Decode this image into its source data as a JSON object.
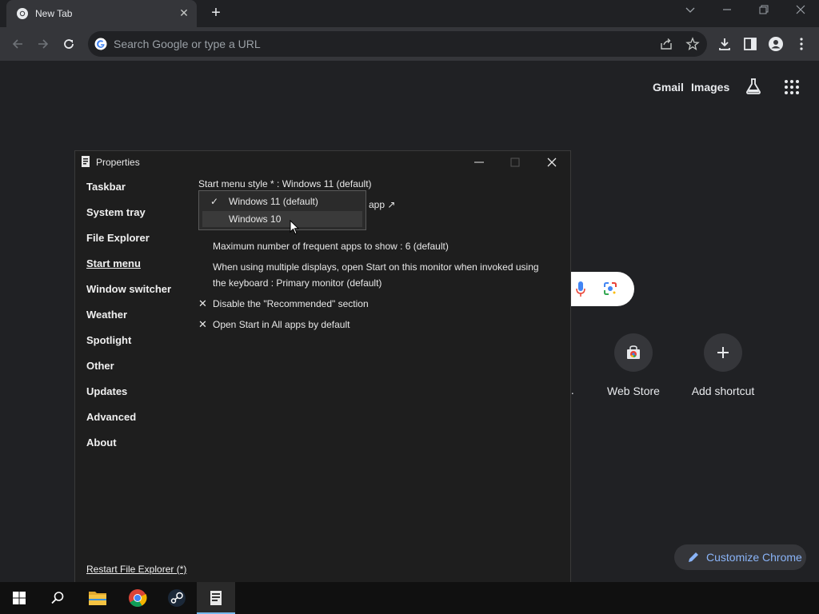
{
  "browser": {
    "tab_title": "New Tab",
    "omnibox_placeholder": "Search Google or type a URL",
    "header_links": [
      "Gmail",
      "Images"
    ],
    "shortcuts": [
      {
        "label": "..."
      },
      {
        "label": "Web Store"
      },
      {
        "label": "Add shortcut"
      }
    ],
    "customize_label": "Customize Chrome"
  },
  "properties_window": {
    "title": "Properties",
    "nav_items": [
      "Taskbar",
      "System tray",
      "File Explorer",
      "Start menu",
      "Window switcher",
      "Weather",
      "Spotlight",
      "Other",
      "Updates",
      "Advanced",
      "About"
    ],
    "active_nav": "Start menu",
    "restart_link": "Restart File Explorer (*)",
    "start_menu_style_label": "Start menu style * : Windows 11 (default)",
    "dropdown_options": [
      {
        "label": "Windows 11 (default)",
        "checked": true
      },
      {
        "label": "Windows 10",
        "checked": false
      }
    ],
    "obscured_fragment": "app ↗",
    "max_frequent_apps": "Maximum number of frequent apps to show : 6 (default)",
    "multi_display_line1": "When using multiple displays, open Start on this monitor when invoked using",
    "multi_display_line2": "the keyboard : Primary monitor (default)",
    "disable_recommended": "Disable the \"Recommended\" section",
    "open_all_apps": "Open Start in All apps by default"
  },
  "taskbar": {
    "apps": [
      "start-button",
      "search",
      "file-explorer",
      "chrome",
      "steam",
      "properties"
    ],
    "active_app": "properties"
  },
  "colors": {
    "chrome_bg": "#202124",
    "toolbar_bg": "#35363a",
    "window_bg": "#1e1e1e",
    "accent_link": "#8ab4f8",
    "taskbar_bg": "#101010",
    "taskbar_indicator": "#76b9ed"
  }
}
